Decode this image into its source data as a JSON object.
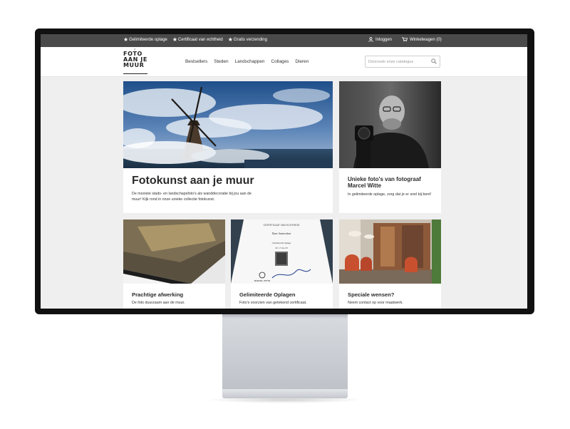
{
  "topbar": {
    "usps": [
      "Gelimiteerde oplage",
      "Certificaat van echtheid",
      "Gratis verzending"
    ],
    "login_label": "Inloggen",
    "cart_label": "Winkelwagen (0)"
  },
  "header": {
    "logo_lines": [
      "FOTO",
      "AAN JE",
      "MUUR"
    ],
    "nav": [
      "Bestsellers",
      "Steden",
      "Landschappen",
      "Collages",
      "Dieren"
    ],
    "search_placeholder": "Doorzoek onze catalogus"
  },
  "hero": {
    "title": "Fotokunst aan je muur",
    "subtitle": "De mooiste stads- en landschapsfoto's als wanddecoratie bij jou aan de muur! Kijk rond in onze unieke collectie fotokunst."
  },
  "side": {
    "title": "Unieke foto's van fotograaf Marcel Witte",
    "subtitle": "In gelimiteerde oplage, zorg dat je er snel bij bent!"
  },
  "cards": [
    {
      "title": "Prachtige afwerking",
      "subtitle": "De foto duurzaam aan de muur."
    },
    {
      "title": "Gelimiteerde Oplagen",
      "subtitle": "Foto's voorzien van getekend certificaat."
    },
    {
      "title": "Speciale wensen?",
      "subtitle": "Neem contact op voor maatwerk."
    }
  ],
  "certificate": {
    "heading": "CERTIFICAAT VAN ECHTHEID",
    "script": "Dam Amsterdam",
    "line1": "Gelimiteerde Oplage",
    "line2": "Nr. 17 van 30",
    "name": "MARCEL WITTE"
  },
  "colors": {
    "topbar": "#4a4a4a",
    "page_bg": "#efefef",
    "monitor_frame": "#111111",
    "stand": "#c9ccd2"
  }
}
